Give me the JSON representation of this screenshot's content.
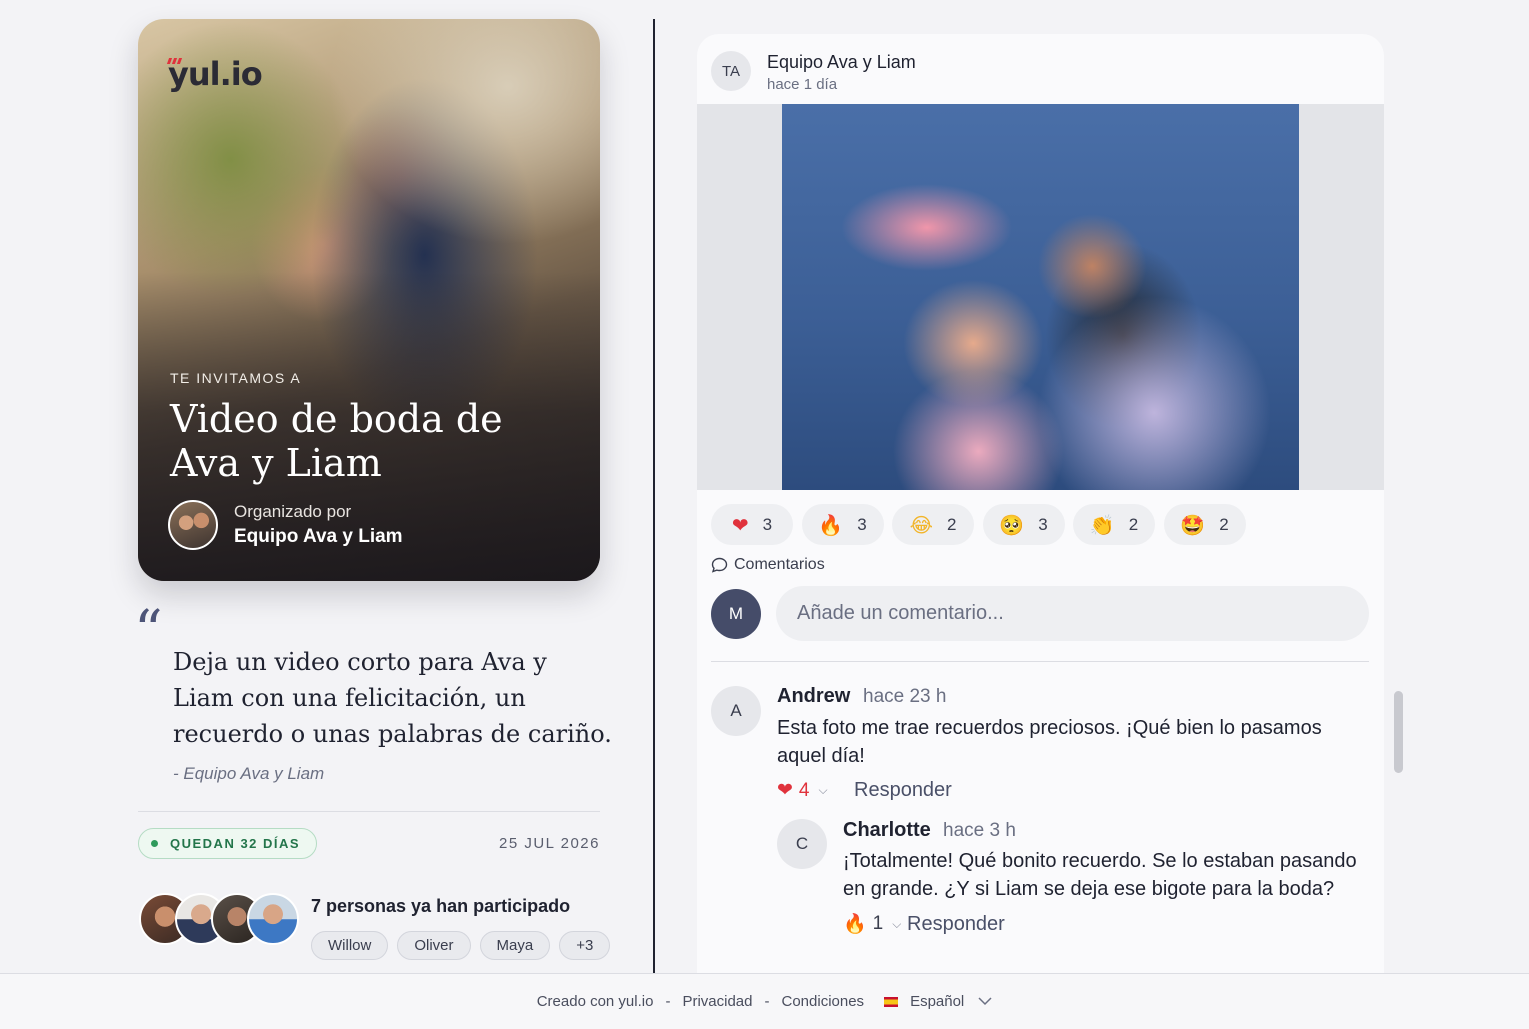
{
  "invitation": {
    "logo": "yul.io",
    "eyebrow": "TE INVITAMOS A",
    "title": "Video de boda de Ava y Liam",
    "host_label": "Organizado por",
    "host_name": "Equipo Ava y Liam",
    "quote_mark": "“",
    "quote": "Deja un video corto para Ava y Liam con una felicitación, un recuerdo o unas palabras de cariño.",
    "quote_author": "- Equipo Ava y Liam",
    "days_left": "QUEDAN 32 DÍAS",
    "event_date": "25 JUL 2026",
    "participants_count": "7 personas ya han participado",
    "participant_chips": [
      "Willow",
      "Oliver",
      "Maya",
      "+3"
    ]
  },
  "post": {
    "author_initials": "TA",
    "author": "Equipo Ava y Liam",
    "time": "hace 1 día",
    "reactions": [
      {
        "emoji": "❤",
        "icon": "heart-icon",
        "count": "3"
      },
      {
        "emoji": "🔥",
        "icon": "fire-icon",
        "count": "3"
      },
      {
        "emoji": "😂",
        "icon": "laughing-face-icon",
        "count": "2"
      },
      {
        "emoji": "🥺",
        "icon": "pleading-face-icon",
        "count": "3"
      },
      {
        "emoji": "👏",
        "icon": "clapping-hands-icon",
        "count": "2"
      },
      {
        "emoji": "🤩",
        "icon": "star-struck-face-icon",
        "count": "2"
      }
    ],
    "comments_label": "Comentarios",
    "my_initial": "M",
    "comment_placeholder": "Añade un comentario...",
    "comments": [
      {
        "initial": "A",
        "name": "Andrew",
        "time": "hace 23 h",
        "text": "Esta foto me trae recuerdos preciosos. ¡Qué bien lo pasamos aquel día!",
        "reaction_emoji": "❤",
        "reaction_count": "4",
        "reply_label": "Responder"
      },
      {
        "initial": "C",
        "name": "Charlotte",
        "time": "hace 3 h",
        "text": "¡Totalmente! Qué bonito recuerdo. Se lo estaban pasando en grande. ¿Y si Liam se deja ese bigote para la boda?",
        "reaction_emoji": "🔥",
        "reaction_count": "1",
        "reply_label": "Responder"
      }
    ]
  },
  "footer": {
    "made_with": "Creado con yul.io",
    "privacy": "Privacidad",
    "terms": "Condiciones",
    "language": "Español",
    "separator": "-"
  },
  "colors": {
    "accent_dark": "#454c69",
    "badge_green": "#23754a",
    "heart_red": "#e0323c"
  }
}
